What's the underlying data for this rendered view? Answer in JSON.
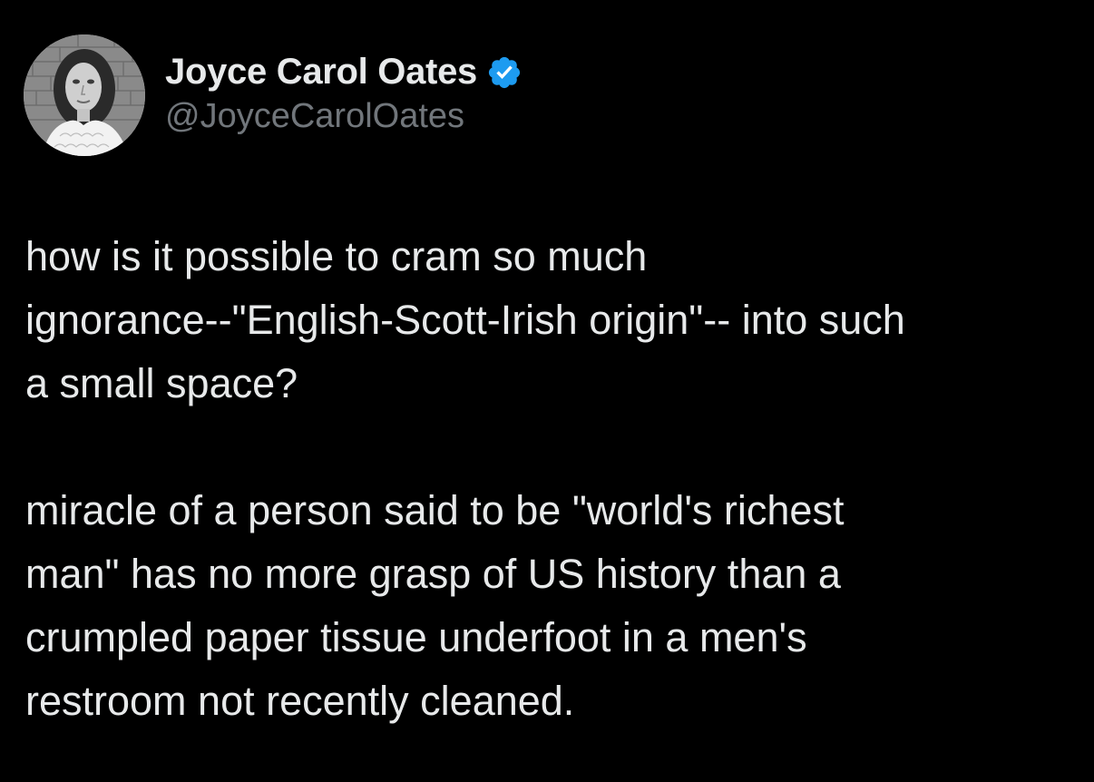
{
  "author": {
    "display_name": "Joyce Carol Oates",
    "handle": "@JoyceCarolOates",
    "verified_badge_icon": "verified-badge-icon",
    "verified_color": "#1d9bf0"
  },
  "tweet": {
    "paragraphs": [
      "how is it possible to cram so much\nignorance--\"English-Scott-Irish origin\"-- into such\na small space?",
      "miracle of a person said to be \"world's richest\nman\" has no more grasp of US history than a\ncrumpled paper tissue underfoot in a men's\nrestroom not recently cleaned."
    ]
  },
  "colors": {
    "background": "#000000",
    "text": "#e7e9ea",
    "secondary_text": "#71767b"
  }
}
